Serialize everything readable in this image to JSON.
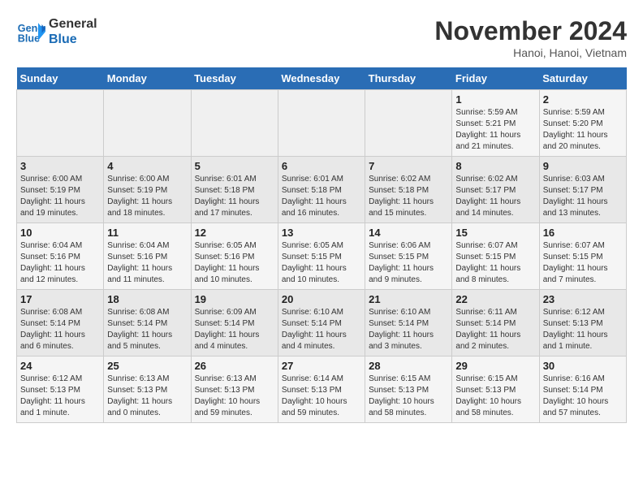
{
  "header": {
    "logo_line1": "General",
    "logo_line2": "Blue",
    "month": "November 2024",
    "location": "Hanoi, Hanoi, Vietnam"
  },
  "days_of_week": [
    "Sunday",
    "Monday",
    "Tuesday",
    "Wednesday",
    "Thursday",
    "Friday",
    "Saturday"
  ],
  "weeks": [
    [
      {
        "day": "",
        "info": ""
      },
      {
        "day": "",
        "info": ""
      },
      {
        "day": "",
        "info": ""
      },
      {
        "day": "",
        "info": ""
      },
      {
        "day": "",
        "info": ""
      },
      {
        "day": "1",
        "info": "Sunrise: 5:59 AM\nSunset: 5:21 PM\nDaylight: 11 hours and 21 minutes."
      },
      {
        "day": "2",
        "info": "Sunrise: 5:59 AM\nSunset: 5:20 PM\nDaylight: 11 hours and 20 minutes."
      }
    ],
    [
      {
        "day": "3",
        "info": "Sunrise: 6:00 AM\nSunset: 5:19 PM\nDaylight: 11 hours and 19 minutes."
      },
      {
        "day": "4",
        "info": "Sunrise: 6:00 AM\nSunset: 5:19 PM\nDaylight: 11 hours and 18 minutes."
      },
      {
        "day": "5",
        "info": "Sunrise: 6:01 AM\nSunset: 5:18 PM\nDaylight: 11 hours and 17 minutes."
      },
      {
        "day": "6",
        "info": "Sunrise: 6:01 AM\nSunset: 5:18 PM\nDaylight: 11 hours and 16 minutes."
      },
      {
        "day": "7",
        "info": "Sunrise: 6:02 AM\nSunset: 5:18 PM\nDaylight: 11 hours and 15 minutes."
      },
      {
        "day": "8",
        "info": "Sunrise: 6:02 AM\nSunset: 5:17 PM\nDaylight: 11 hours and 14 minutes."
      },
      {
        "day": "9",
        "info": "Sunrise: 6:03 AM\nSunset: 5:17 PM\nDaylight: 11 hours and 13 minutes."
      }
    ],
    [
      {
        "day": "10",
        "info": "Sunrise: 6:04 AM\nSunset: 5:16 PM\nDaylight: 11 hours and 12 minutes."
      },
      {
        "day": "11",
        "info": "Sunrise: 6:04 AM\nSunset: 5:16 PM\nDaylight: 11 hours and 11 minutes."
      },
      {
        "day": "12",
        "info": "Sunrise: 6:05 AM\nSunset: 5:16 PM\nDaylight: 11 hours and 10 minutes."
      },
      {
        "day": "13",
        "info": "Sunrise: 6:05 AM\nSunset: 5:15 PM\nDaylight: 11 hours and 10 minutes."
      },
      {
        "day": "14",
        "info": "Sunrise: 6:06 AM\nSunset: 5:15 PM\nDaylight: 11 hours and 9 minutes."
      },
      {
        "day": "15",
        "info": "Sunrise: 6:07 AM\nSunset: 5:15 PM\nDaylight: 11 hours and 8 minutes."
      },
      {
        "day": "16",
        "info": "Sunrise: 6:07 AM\nSunset: 5:15 PM\nDaylight: 11 hours and 7 minutes."
      }
    ],
    [
      {
        "day": "17",
        "info": "Sunrise: 6:08 AM\nSunset: 5:14 PM\nDaylight: 11 hours and 6 minutes."
      },
      {
        "day": "18",
        "info": "Sunrise: 6:08 AM\nSunset: 5:14 PM\nDaylight: 11 hours and 5 minutes."
      },
      {
        "day": "19",
        "info": "Sunrise: 6:09 AM\nSunset: 5:14 PM\nDaylight: 11 hours and 4 minutes."
      },
      {
        "day": "20",
        "info": "Sunrise: 6:10 AM\nSunset: 5:14 PM\nDaylight: 11 hours and 4 minutes."
      },
      {
        "day": "21",
        "info": "Sunrise: 6:10 AM\nSunset: 5:14 PM\nDaylight: 11 hours and 3 minutes."
      },
      {
        "day": "22",
        "info": "Sunrise: 6:11 AM\nSunset: 5:14 PM\nDaylight: 11 hours and 2 minutes."
      },
      {
        "day": "23",
        "info": "Sunrise: 6:12 AM\nSunset: 5:13 PM\nDaylight: 11 hours and 1 minute."
      }
    ],
    [
      {
        "day": "24",
        "info": "Sunrise: 6:12 AM\nSunset: 5:13 PM\nDaylight: 11 hours and 1 minute."
      },
      {
        "day": "25",
        "info": "Sunrise: 6:13 AM\nSunset: 5:13 PM\nDaylight: 11 hours and 0 minutes."
      },
      {
        "day": "26",
        "info": "Sunrise: 6:13 AM\nSunset: 5:13 PM\nDaylight: 10 hours and 59 minutes."
      },
      {
        "day": "27",
        "info": "Sunrise: 6:14 AM\nSunset: 5:13 PM\nDaylight: 10 hours and 59 minutes."
      },
      {
        "day": "28",
        "info": "Sunrise: 6:15 AM\nSunset: 5:13 PM\nDaylight: 10 hours and 58 minutes."
      },
      {
        "day": "29",
        "info": "Sunrise: 6:15 AM\nSunset: 5:13 PM\nDaylight: 10 hours and 58 minutes."
      },
      {
        "day": "30",
        "info": "Sunrise: 6:16 AM\nSunset: 5:14 PM\nDaylight: 10 hours and 57 minutes."
      }
    ]
  ]
}
